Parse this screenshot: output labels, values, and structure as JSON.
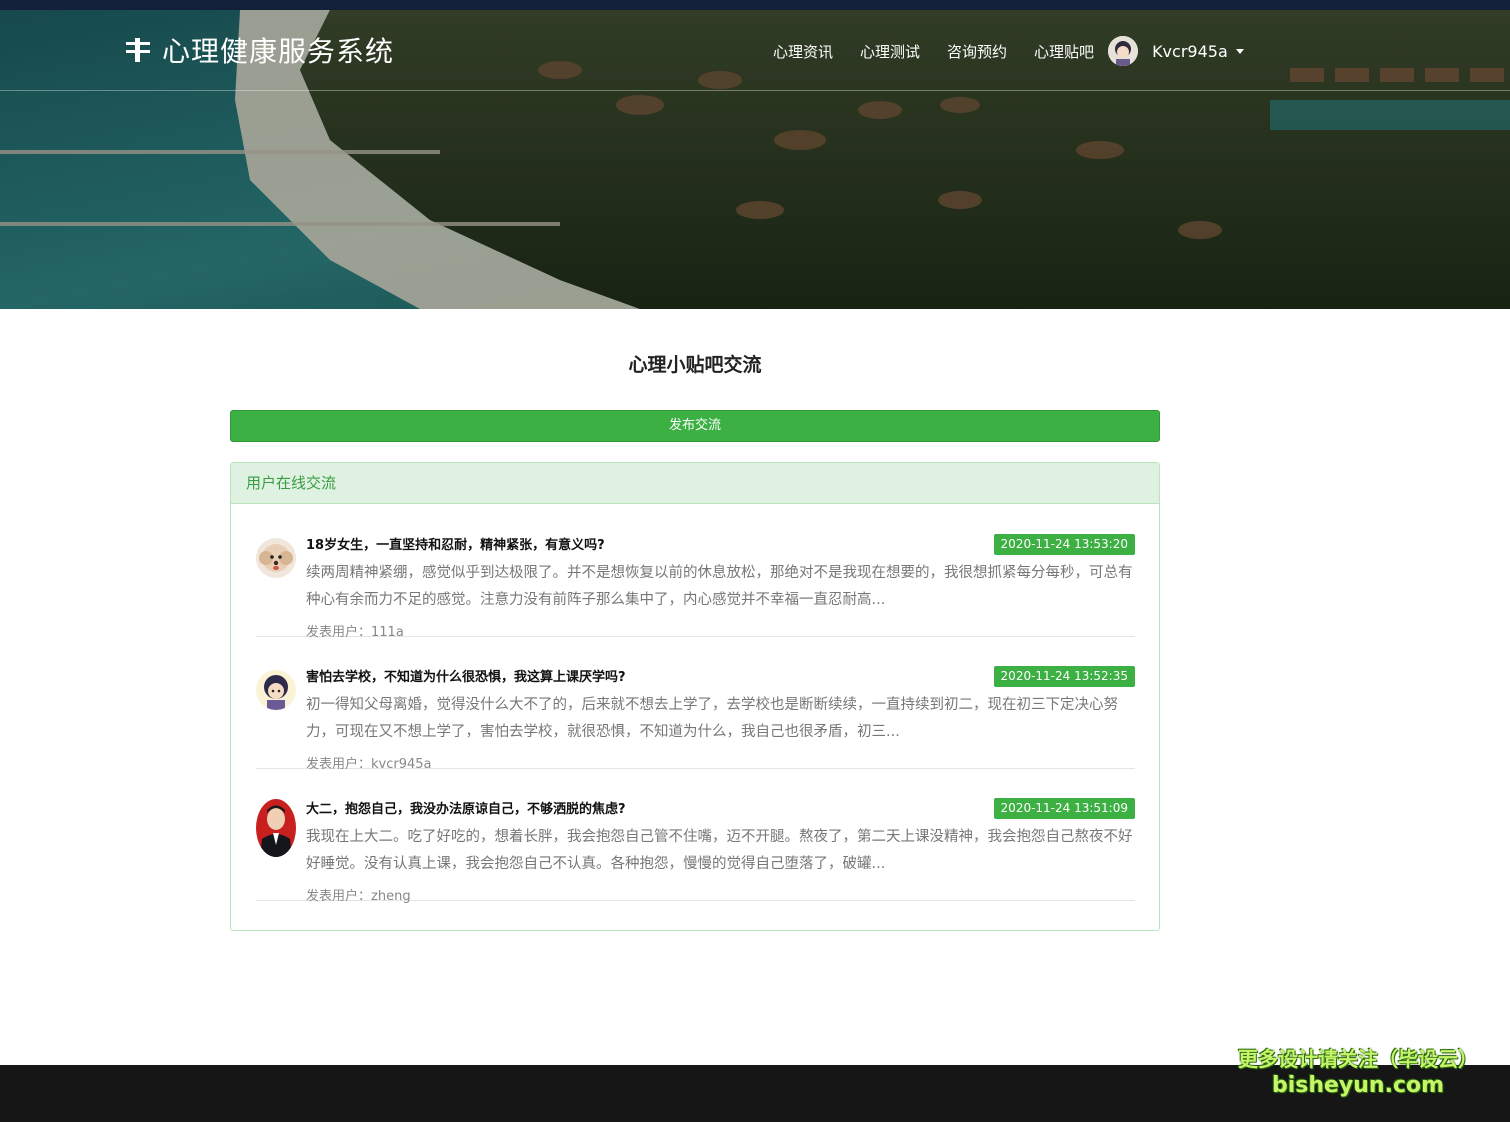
{
  "nav": {
    "brand": "心理健康服务系统",
    "items": [
      "心理资讯",
      "心理测试",
      "咨询预约",
      "心理贴吧"
    ],
    "username": "Kvcr945a"
  },
  "main": {
    "title": "心理小贴吧交流",
    "publish_label": "发布交流",
    "panel_title": "用户在线交流",
    "author_prefix": "发表用户：",
    "posts": [
      {
        "title": "18岁女生，一直坚持和忍耐，精神紧张，有意义吗?",
        "date": "2020-11-24 13:53:20",
        "body": "续两周精神紧绷，感觉似乎到达极限了。并不是想恢复以前的休息放松，那绝对不是我现在想要的，我很想抓紧每分每秒，可总有种心有余而力不足的感觉。注意力没有前阵子那么集中了，内心感觉并不幸福一直忍耐高...",
        "author": "111a",
        "avatar": "poodle-avatar"
      },
      {
        "title": "害怕去学校，不知道为什么很恐惧，我这算上课厌学吗?",
        "date": "2020-11-24 13:52:35",
        "body": "初一得知父母离婚，觉得没什么大不了的，后来就不想去上学了，去学校也是断断续续，一直持续到初二，现在初三下定决心努力，可现在又不想上学了，害怕去学校，就很恐惧，不知道为什么，我自己也很矛盾，初三...",
        "author": "kvcr945a",
        "avatar": "cartoon-avatar"
      },
      {
        "title": "大二，抱怨自己，我没办法原谅自己，不够洒脱的焦虑?",
        "date": "2020-11-24 13:51:09",
        "body": "我现在上大二。吃了好吃的，想着长胖，我会抱怨自己管不住嘴，迈不开腿。熬夜了，第二天上课没精神，我会抱怨自己熬夜不好好睡觉。没有认真上课，我会抱怨自己不认真。各种抱怨，慢慢的觉得自己堕落了，破罐...",
        "author": "zheng",
        "avatar": "portrait-avatar"
      }
    ]
  },
  "watermark": {
    "line1": "更多设计请关注（毕设云）",
    "line2": "bisheyun.com"
  },
  "colors": {
    "accent": "#3cb043",
    "panel_head_bg": "#dff2e1",
    "footer": "#161616"
  }
}
